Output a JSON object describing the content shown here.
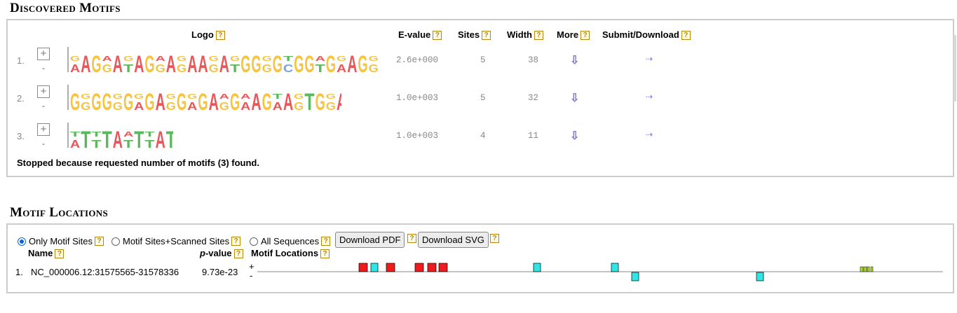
{
  "discovered": {
    "title": "Discovered Motifs",
    "headers": {
      "logo": "Logo",
      "evalue": "E-value",
      "sites": "Sites",
      "width": "Width",
      "more": "More",
      "submit": "Submit/Download"
    },
    "motifs": [
      {
        "num": "1.",
        "expand": "+",
        "collapse": "-",
        "evalue": "2.6e+000",
        "sites": "5",
        "width": "38",
        "logo_letters": "AAGGATAGGAGAAGATGGGGCGGTGAAGG"
      },
      {
        "num": "2.",
        "expand": "+",
        "collapse": "-",
        "evalue": "1.0e+003",
        "sites": "5",
        "width": "32",
        "logo_letters": "GGGGGGAGAGGAGAGGAAGAAGTGGAT"
      },
      {
        "num": "3.",
        "expand": "+",
        "collapse": "-",
        "evalue": "1.0e+003",
        "sites": "4",
        "width": "11",
        "logo_letters": "ATTTATTTATT"
      }
    ],
    "stopped_text": "Stopped because requested number of motifs (3) found."
  },
  "locations": {
    "title": "Motif Locations",
    "options": [
      {
        "label": "Only Motif Sites",
        "checked": true
      },
      {
        "label": "Motif Sites+Scanned Sites",
        "checked": false
      },
      {
        "label": "All Sequences",
        "checked": false
      }
    ],
    "download_pdf": "Download PDF",
    "download_svg": "Download SVG",
    "headers": {
      "name": "Name",
      "p_prefix": "p",
      "pvalue": "-value",
      "motif_locations": "Motif Locations"
    },
    "rows": [
      {
        "num": "1.",
        "name": "NC_000006.12:31575565-31578336",
        "pvalue": "9.73e-23",
        "plus": "+",
        "minus": "-"
      }
    ]
  },
  "help_mark": "?",
  "colors": {
    "A": "#e8585a",
    "C": "#7b9fe0",
    "G": "#f5c542",
    "T": "#5cb85c",
    "motif1": "#ee1c1c",
    "motif2": "#2ee6e6",
    "motif3": "#aadd22",
    "link": "#7b7bd6",
    "border": "#cccccc"
  }
}
